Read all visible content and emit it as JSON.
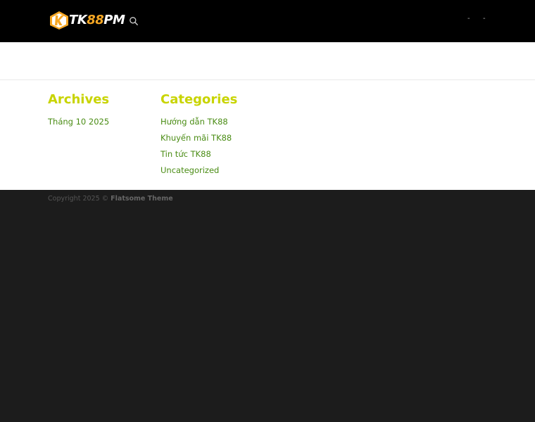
{
  "header": {
    "logo": {
      "prefix": "TK",
      "number": "88",
      "suffix": "PM"
    },
    "search_icon": "search-icon",
    "nav_dashes": [
      "-",
      "-"
    ]
  },
  "widgets": {
    "archives": {
      "title": "Archives",
      "items": [
        "Tháng 10 2025"
      ]
    },
    "categories": {
      "title": "Categories",
      "items": [
        "Hướng dẫn TK88",
        "Khuyến mãi TK88",
        "Tin tức TK88",
        "Uncategorized"
      ]
    }
  },
  "footer": {
    "copyright_prefix": "Copyright 2025 © ",
    "theme": "Flatsome Theme"
  },
  "colors": {
    "header_bg": "#000000",
    "widget_title": "#c8d400",
    "link": "#4a8c14",
    "footer_bg": "#1c1c1c",
    "logo_orange": "#f5a623"
  }
}
